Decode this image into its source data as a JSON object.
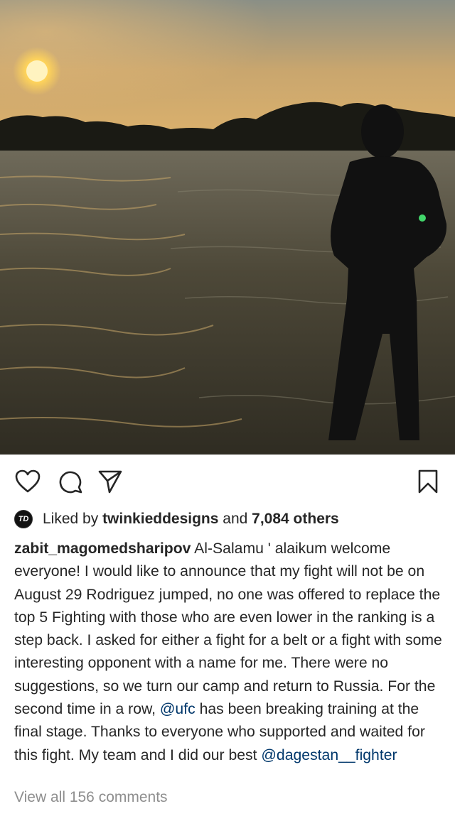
{
  "post": {
    "likes": {
      "prefix": "Liked by ",
      "liker": "twinkieddesigns",
      "middle": " and ",
      "count_text": "7,084 others"
    },
    "caption": {
      "username": "zabit_magomedsharipov",
      "part1": " Al-Salamu ' alaikum welcome everyone! I would like to announce that my fight will not be on August 29 Rodriguez jumped, no one was offered to replace the top 5 Fighting with those who are even lower in the ranking is a step back. I asked for either a fight for a belt or a fight with some interesting opponent with a name for me. There were no suggestions, so we turn our camp and return to Russia. For the second time in a row, ",
      "mention1": "@ufc",
      "part2": " has been breaking training at the final stage. Thanks to everyone who supported and waited for this fight. My team and I did our best ",
      "mention2": "@dagestan__fighter"
    },
    "view_all_comments": "View all 156 comments"
  },
  "icons": {
    "like": "heart-icon",
    "comment": "comment-icon",
    "share": "send-icon",
    "save": "bookmark-icon"
  }
}
